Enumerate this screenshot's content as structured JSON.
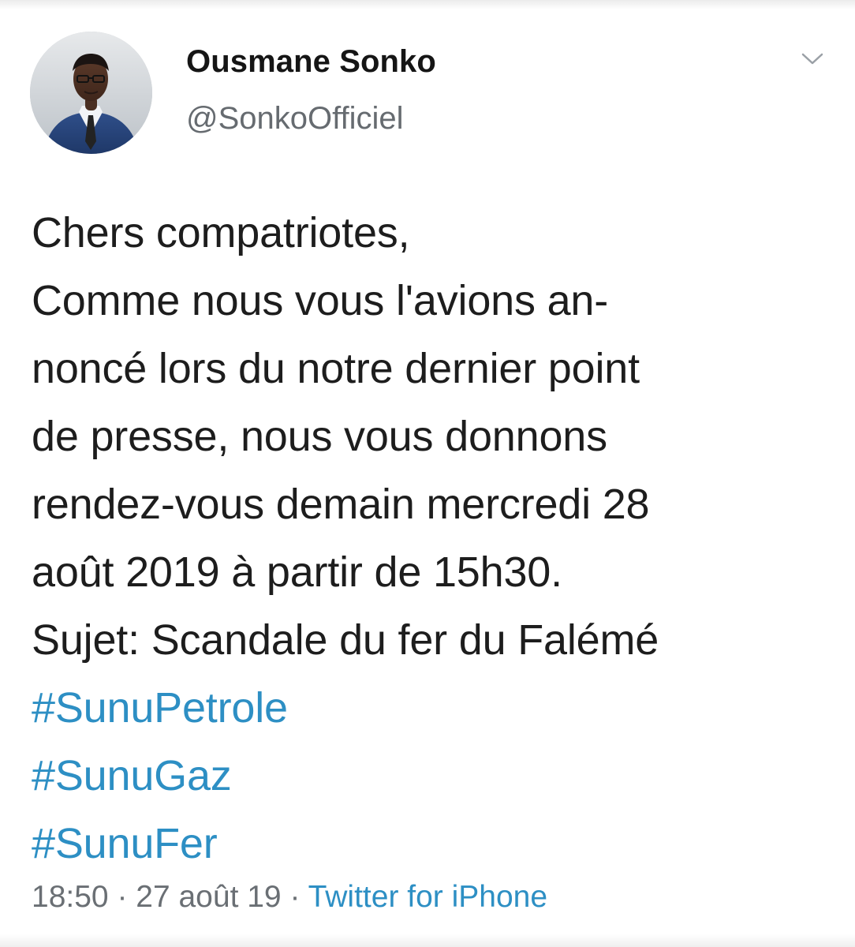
{
  "header": {
    "user_name": "Ousmane Sonko",
    "user_handle": "@SonkoOfficiel"
  },
  "tweet": {
    "lines": [
      "Chers compatriotes,",
      "Comme nous vous l'avions an-",
      "noncé lors du notre dernier point",
      "de presse, nous vous donnons",
      "rendez-vous demain mercredi 28",
      "août 2019 à partir de 15h30.",
      "Sujet: Scandale du fer du Falémé"
    ],
    "hashtags": [
      "#SunuPetrole",
      "#SunuGaz",
      "#SunuFer"
    ]
  },
  "meta": {
    "time": "18:50",
    "separator": " · ",
    "date": "27 août 19",
    "source": "Twitter for iPhone"
  },
  "icons": {
    "avatar": "profile-photo",
    "menu": "chevron-down-icon"
  },
  "colors": {
    "hashtag": "#2d8fc4",
    "meta": "#6a6f74"
  }
}
